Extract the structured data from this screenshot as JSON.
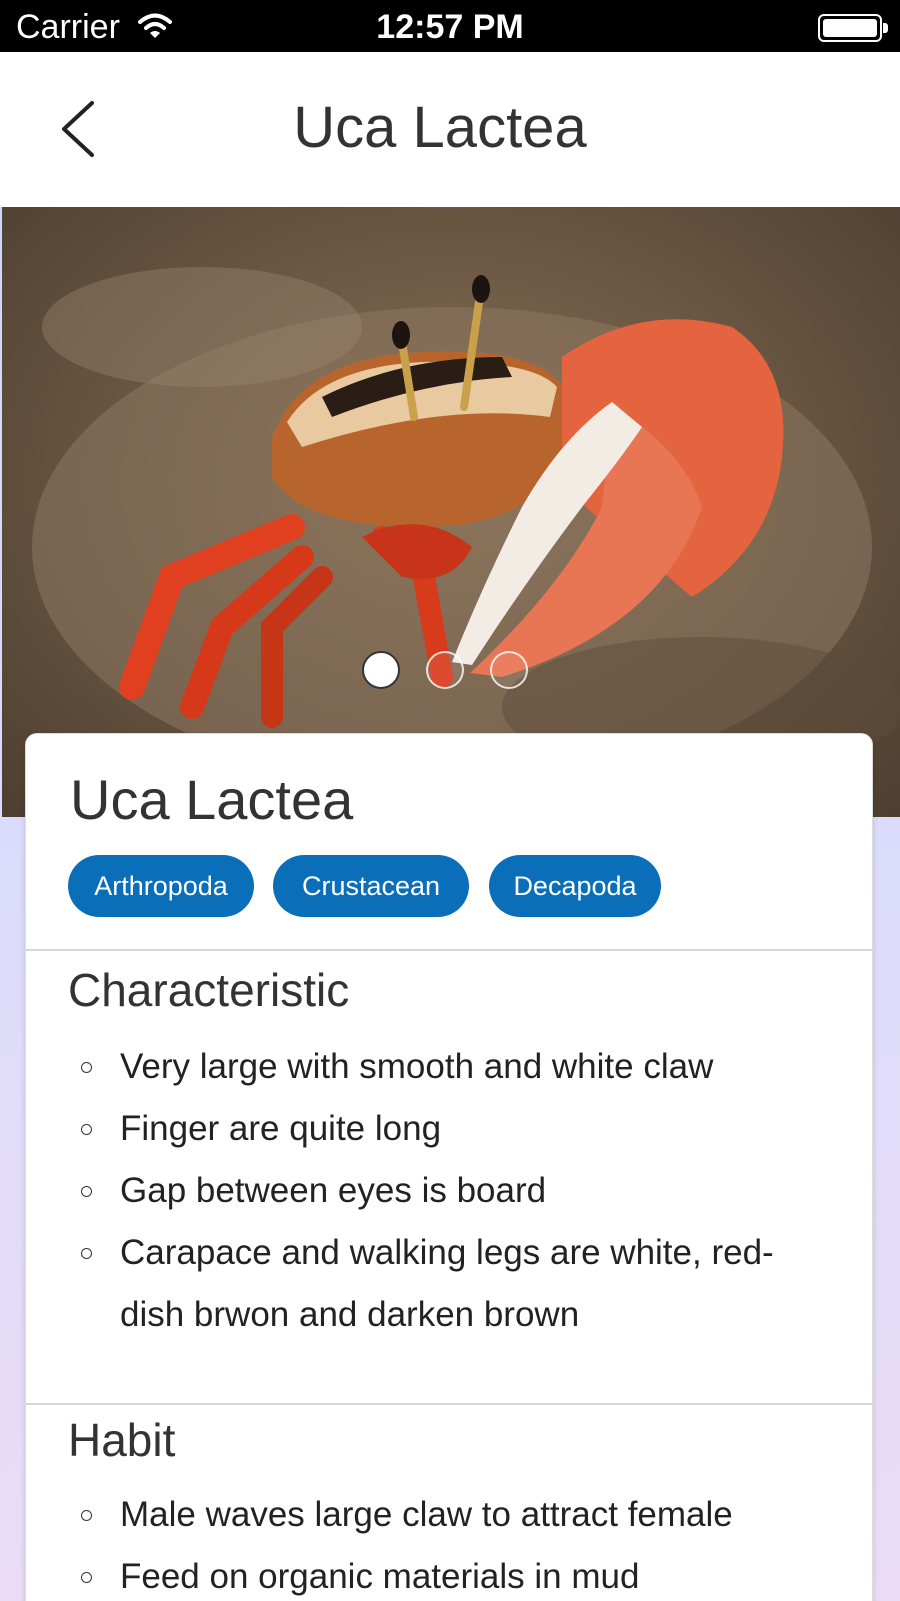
{
  "status_bar": {
    "carrier": "Carrier",
    "time": "12:57 PM",
    "wifi_icon": "wifi-icon",
    "battery_icon": "battery-icon"
  },
  "nav": {
    "title": "Uca Lactea",
    "back_icon": "chevron-left-icon"
  },
  "hero": {
    "image": "fiddler-crab-photo",
    "page_count": 3,
    "active_page": 1
  },
  "card": {
    "title": "Uca Lactea",
    "tags": [
      "Arthropoda",
      "Crustacean",
      "Decapoda"
    ],
    "sections": [
      {
        "title": "Characteristic",
        "items": [
          "Very large with smooth and white claw",
          "Finger are quite long",
          "Gap between eyes is board",
          "Carapace and walking legs are white, red-dish brwon and darken brown"
        ]
      },
      {
        "title": "Habit",
        "items": [
          "Male waves large claw to attract female",
          "Feed on organic materials in mud"
        ]
      }
    ]
  },
  "colors": {
    "tag_background": "#0a6fb8",
    "text": "#333333",
    "background_top": "#c9d6fb",
    "background_bottom": "#eadcf6"
  }
}
